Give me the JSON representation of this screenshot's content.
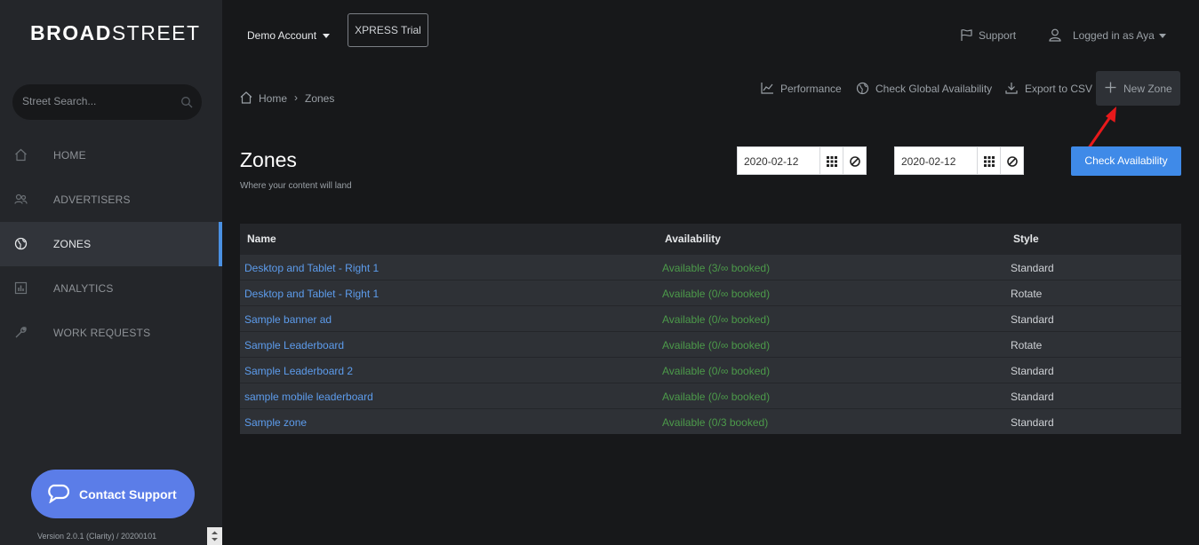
{
  "brand": {
    "logo_bold": "BROAD",
    "logo_light": "STREET"
  },
  "sidebar": {
    "search_placeholder": "Street Search...",
    "items": [
      {
        "label": "HOME",
        "icon": "home-icon",
        "active": false
      },
      {
        "label": "ADVERTISERS",
        "icon": "users-icon",
        "active": false
      },
      {
        "label": "ZONES",
        "icon": "globe-icon",
        "active": true
      },
      {
        "label": "ANALYTICS",
        "icon": "chart-icon",
        "active": false
      },
      {
        "label": "WORK REQUESTS",
        "icon": "wrench-icon",
        "active": false
      }
    ],
    "contact_label": "Contact Support",
    "version": "Version 2.0.1 (Clarity) / 20200101"
  },
  "header": {
    "account": "Demo Account",
    "trial": "XPRESS Trial",
    "support": "Support",
    "logged_in": "Logged in as Aya"
  },
  "breadcrumb": {
    "home": "Home",
    "separator": "›",
    "current": "Zones"
  },
  "toolbar": {
    "performance": "Performance",
    "global": "Check Global Availability",
    "export": "Export to CSV",
    "new_zone": "New Zone"
  },
  "page": {
    "title": "Zones",
    "subtitle": "Where your content will land"
  },
  "dates": {
    "start": "2020-02-12",
    "end": "2020-02-12",
    "check_label": "Check Availability"
  },
  "table": {
    "headers": {
      "name": "Name",
      "availability": "Availability",
      "style": "Style"
    },
    "rows": [
      {
        "name": "Desktop and Tablet - Right 1",
        "availability": "Available (3/∞ booked)",
        "style": "Standard"
      },
      {
        "name": "Desktop and Tablet - Right 1",
        "availability": "Available (0/∞ booked)",
        "style": "Rotate"
      },
      {
        "name": "Sample banner ad",
        "availability": "Available (0/∞ booked)",
        "style": "Standard"
      },
      {
        "name": "Sample Leaderboard",
        "availability": "Available (0/∞ booked)",
        "style": "Rotate"
      },
      {
        "name": "Sample Leaderboard 2",
        "availability": "Available (0/∞ booked)",
        "style": "Standard"
      },
      {
        "name": "sample mobile leaderboard",
        "availability": "Available (0/∞ booked)",
        "style": "Standard"
      },
      {
        "name": "Sample zone",
        "availability": "Available (0/3 booked)",
        "style": "Standard"
      }
    ]
  },
  "colors": {
    "accent": "#4a90e2",
    "primary_button": "#3f8ae8",
    "contact": "#5b7de8",
    "available": "#4c9a4a",
    "link": "#5d9cec",
    "annotation_arrow": "#e8191b"
  }
}
